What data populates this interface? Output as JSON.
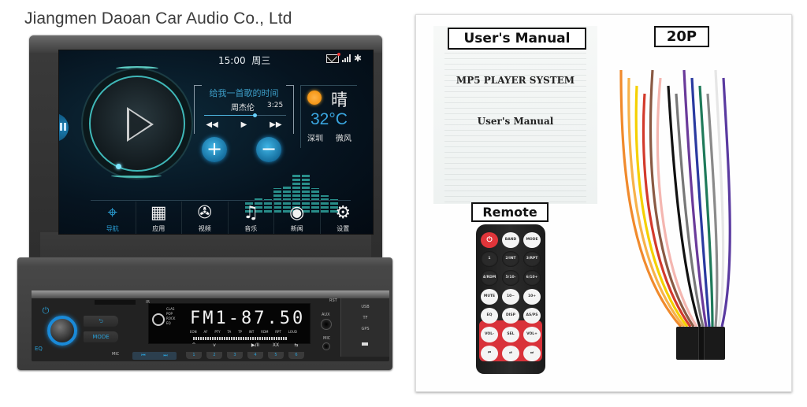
{
  "company": "Jiangmen Daoan Car Audio Co., Ltd",
  "head_unit": {
    "screen": {
      "status": {
        "time": "15:00",
        "weekday": "周三",
        "icons": [
          "mail-icon",
          "signal-icon",
          "bluetooth-icon"
        ]
      },
      "music": {
        "title": "给我一首歌的时间",
        "artist": "周杰伦",
        "duration": "3:25",
        "progress_percent": 62,
        "controls": {
          "rewind": "◀◀",
          "play": "▶",
          "forward": "▶▶"
        }
      },
      "volume": {
        "up": "+",
        "down": "−"
      },
      "equalizer_levels": [
        0.25,
        0.35,
        0.3,
        0.55,
        0.6,
        0.9,
        0.85,
        0.55,
        0.4,
        0.3
      ],
      "weather": {
        "condition": "晴",
        "temperature": "32°C",
        "city": "深圳",
        "wind": "微风"
      },
      "dock": [
        {
          "label": "导航",
          "icon": "compass-icon",
          "glyph": "⌖",
          "active": true
        },
        {
          "label": "应用",
          "icon": "apps-grid-icon",
          "glyph": "▦",
          "active": false
        },
        {
          "label": "视频",
          "icon": "film-reel-icon",
          "glyph": "✇",
          "active": false
        },
        {
          "label": "音乐",
          "icon": "music-notes-icon",
          "glyph": "♫",
          "active": false
        },
        {
          "label": "新闻",
          "icon": "globe-icon",
          "glyph": "◉",
          "active": false
        },
        {
          "label": "设置",
          "icon": "gear-icon",
          "glyph": "⚙",
          "active": false
        }
      ]
    },
    "faceplate": {
      "lcd": {
        "frequency": "FM1-87.50",
        "eq_modes": [
          "CLAS",
          "POP",
          "ROCK"
        ],
        "eq_label": "EQ",
        "flags": [
          "EON",
          "AF",
          "PTY",
          "TA",
          "TP",
          "INT",
          "RDM",
          "RPT",
          "LOUD"
        ]
      },
      "buttons": {
        "power": "⏻",
        "eq": "EQ",
        "back": "⮌",
        "mode": "MODE",
        "mic": "MIC",
        "ir": "IR",
        "prev": "⏮",
        "next": "⏭"
      },
      "presets": [
        {
          "number": "1",
          "function": "^"
        },
        {
          "number": "2",
          "function": "v"
        },
        {
          "number": "3",
          "function": ""
        },
        {
          "number": "4",
          "function": "▶/II"
        },
        {
          "number": "5",
          "function": "XX"
        },
        {
          "number": "6",
          "function": "⇆"
        }
      ],
      "jacks": {
        "aux": "AUX",
        "mic": "MIC",
        "rst": "RST"
      },
      "ports": [
        "USB",
        "TF",
        "GPS"
      ]
    }
  },
  "accessories": {
    "manual": {
      "label": "User's Manual",
      "title": "MP5 PLAYER SYSTEM",
      "subtitle": "User's Manual"
    },
    "remote": {
      "label": "Remote",
      "buttons": [
        "⏻",
        "BAND",
        "MODE",
        "1",
        "2/INT",
        "3/RPT",
        "4/RDM",
        "5/10-",
        "6/10+",
        "MUTE",
        "10−",
        "10+",
        "EQ",
        "DISP",
        "AS/PS",
        "VOL-",
        "SEL",
        "VOL+",
        "⏮",
        "⏯",
        "⏭"
      ]
    },
    "harness": {
      "label": "20P",
      "wire_colors": [
        "#f08a2c",
        "#f7b24a",
        "#f5d000",
        "#d33a2c",
        "#8a5a44",
        "#f4b6b0",
        "#111111",
        "#777777",
        "#6a3a9a",
        "#2a3aa0",
        "#1f7a5a",
        "#8a8a8a",
        "#ffffff",
        "#5a3aa0"
      ]
    }
  }
}
